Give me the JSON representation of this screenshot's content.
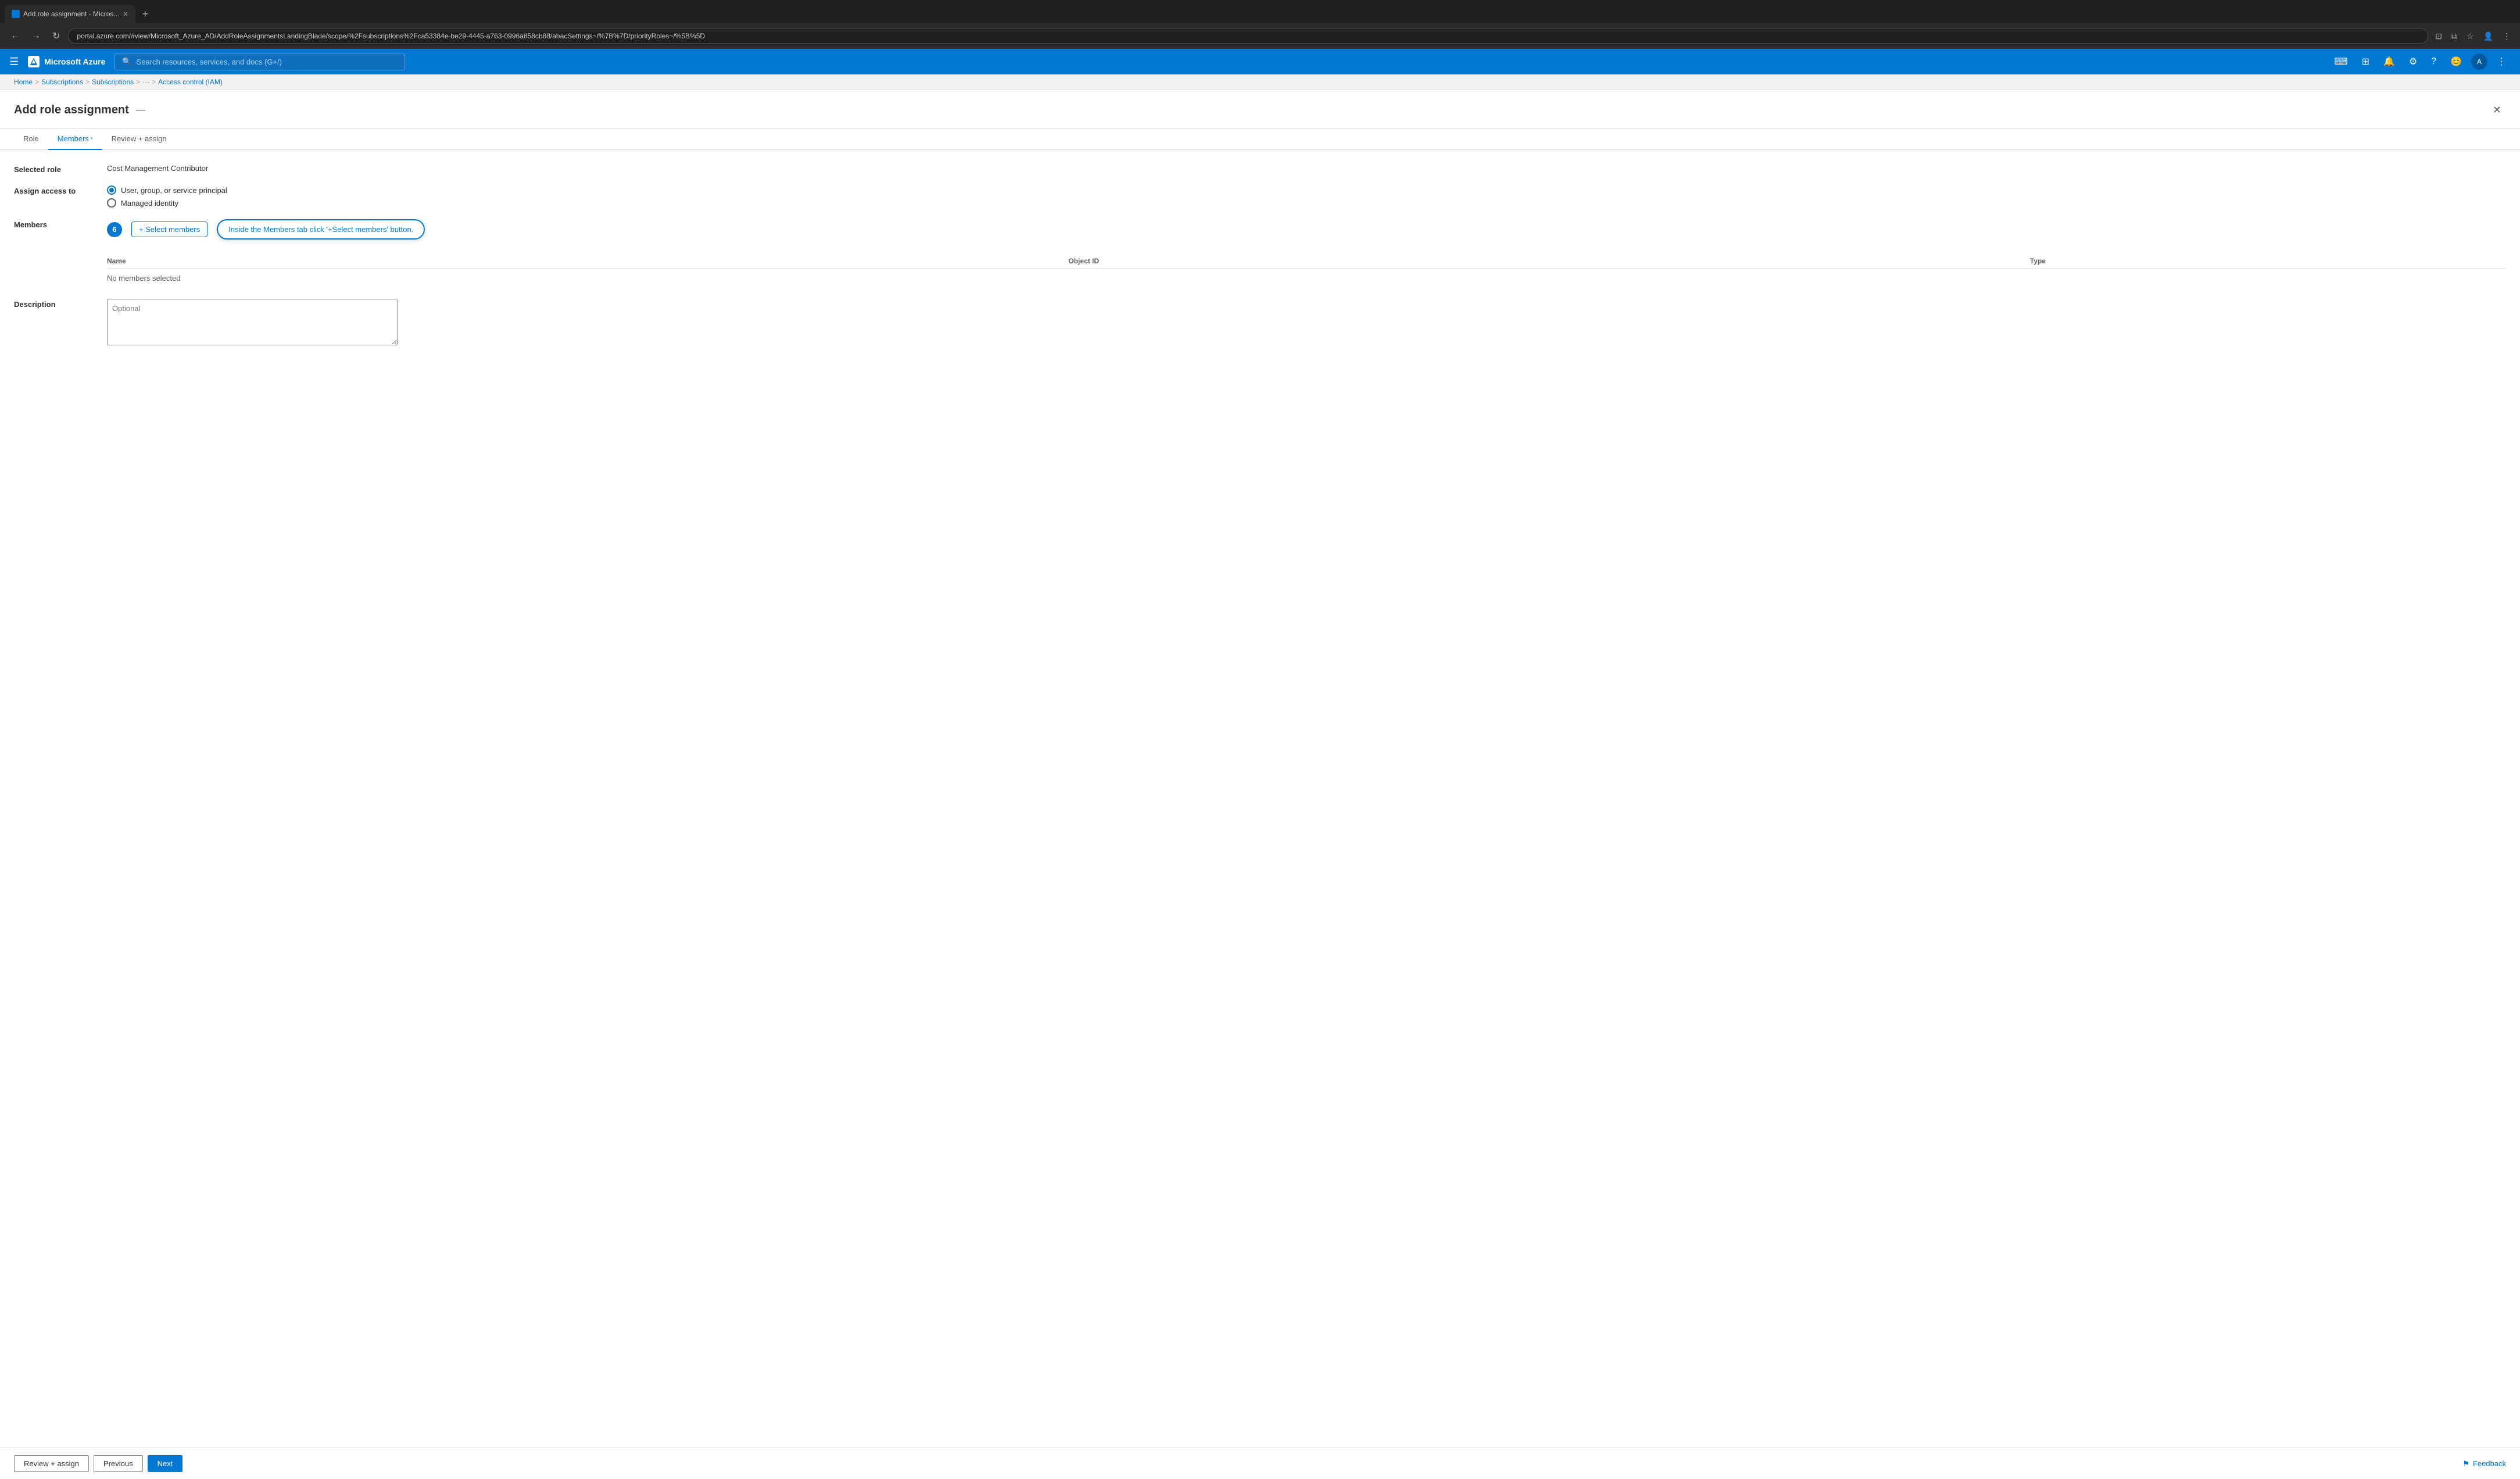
{
  "browser": {
    "tab_title": "Add role assignment - Micros...",
    "tab_favicon": "A",
    "address_bar_url": "portal.azure.com/#view/Microsoft_Azure_AD/AddRoleAssignmentsLandingBlade/scope/%2Fsubscriptions%2Fca53384e-be29-4445-a763-0996a858cb88/abacSettings~/%7B%7D/priorityRoles~/%5B%5D",
    "new_tab_label": "+",
    "nav_back_label": "←",
    "nav_forward_label": "→",
    "nav_reload_label": "↻"
  },
  "azure_topbar": {
    "menu_icon": "☰",
    "brand_name": "Microsoft Azure",
    "search_placeholder": "Search resources, services, and docs (G+/)",
    "icons": [
      "cloud-shell-icon",
      "feedback-topbar-icon",
      "notifications-icon",
      "settings-icon",
      "help-icon",
      "account-icon",
      "more-icon"
    ]
  },
  "breadcrumb": {
    "items": [
      "Home",
      "Subscriptions",
      "Subscriptions",
      "",
      "Access control (IAM)"
    ],
    "separators": [
      ">",
      ">",
      ">",
      ">"
    ]
  },
  "panel": {
    "title": "Add role assignment",
    "subtitle_icon": "—",
    "close_label": "✕"
  },
  "tabs": [
    {
      "id": "role",
      "label": "Role",
      "active": false,
      "asterisk": false
    },
    {
      "id": "members",
      "label": "Members",
      "active": true,
      "asterisk": true
    },
    {
      "id": "review_assign",
      "label": "Review + assign",
      "active": false,
      "asterisk": false
    }
  ],
  "form": {
    "selected_role_label": "Selected role",
    "selected_role_value": "Cost Management Contributor",
    "assign_access_label": "Assign access to",
    "radio_options": [
      {
        "id": "user",
        "label": "User, group, or service principal",
        "selected": true
      },
      {
        "id": "managed",
        "label": "Managed identity",
        "selected": false
      }
    ],
    "members_label": "Members",
    "select_members_btn_label": "+ Select members",
    "step_badge_number": "6",
    "tooltip_text": "Inside the Members tab click '+Select members' button.",
    "table_headers": [
      "Name",
      "Object ID",
      "Type"
    ],
    "no_members_text": "No members selected",
    "description_label": "Description",
    "description_placeholder": "Optional"
  },
  "bottom_bar": {
    "review_assign_label": "Review + assign",
    "previous_label": "Previous",
    "next_label": "Next",
    "feedback_label": "Feedback",
    "feedback_icon": "⚑"
  }
}
